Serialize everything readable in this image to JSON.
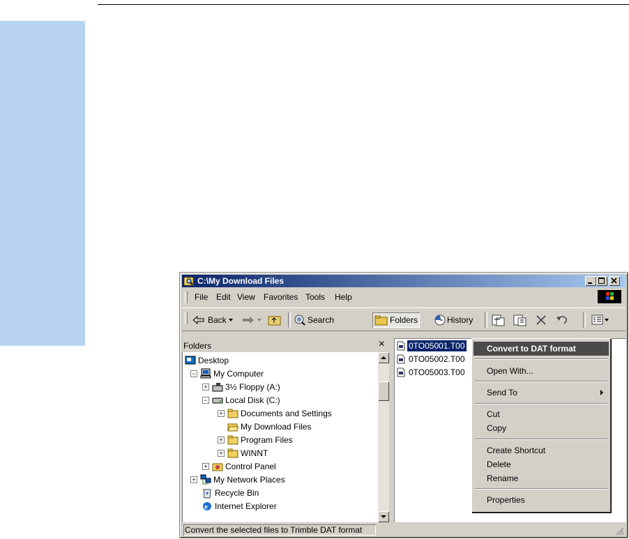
{
  "window": {
    "title": "C:\\My Download Files"
  },
  "menubar": [
    "File",
    "Edit",
    "View",
    "Favorites",
    "Tools",
    "Help"
  ],
  "toolbar": {
    "back": "Back",
    "search": "Search",
    "folders": "Folders",
    "history": "History"
  },
  "folders_pane": {
    "header": "Folders",
    "close": "×",
    "tree": [
      {
        "label": "Desktop",
        "icon": "desktop-icon"
      },
      {
        "label": "My Computer",
        "icon": "my-computer-icon"
      },
      {
        "label": "3½ Floppy (A:)",
        "icon": "floppy-icon"
      },
      {
        "label": "Local Disk (C:)",
        "icon": "disk-icon"
      },
      {
        "label": "Documents and Settings",
        "icon": "folder-icon"
      },
      {
        "label": "My Download Files",
        "icon": "folder-open-icon"
      },
      {
        "label": "Program Files",
        "icon": "folder-icon"
      },
      {
        "label": "WINNT",
        "icon": "folder-icon"
      },
      {
        "label": "Control Panel",
        "icon": "control-panel-icon"
      },
      {
        "label": "My Network Places",
        "icon": "network-icon"
      },
      {
        "label": "Recycle Bin",
        "icon": "recycle-bin-icon"
      },
      {
        "label": "Internet Explorer",
        "icon": "ie-icon"
      }
    ]
  },
  "files": [
    "0TO05001.T00",
    "0TO05002.T00",
    "0TO05003.T00"
  ],
  "context_menu": {
    "convert": "Convert to DAT format",
    "open_with": "Open With...",
    "send_to": "Send To",
    "cut": "Cut",
    "copy": "Copy",
    "create_shortcut": "Create Shortcut",
    "delete": "Delete",
    "rename": "Rename",
    "properties": "Properties"
  },
  "status": {
    "text": "Convert the selected files to Trimble DAT format"
  },
  "colors": {
    "side_band": "#b7d3f0",
    "title_active": "#0a246a",
    "face": "#d4d0c8"
  }
}
